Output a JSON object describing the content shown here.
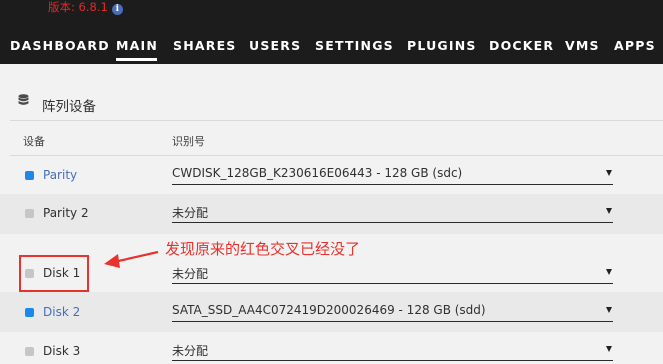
{
  "header": {
    "version": "版本: 6.8.1",
    "nav": [
      "DASHBOARD",
      "MAIN",
      "SHARES",
      "USERS",
      "SETTINGS",
      "PLUGINS",
      "DOCKER",
      "VMS",
      "APPS"
    ],
    "active_tab": "MAIN"
  },
  "panel": {
    "title": "阵列设备",
    "icon": "database-icon",
    "columns": {
      "device": "设备",
      "identification": "识别号"
    },
    "rows": [
      {
        "name": "Parity",
        "value": "CWDISK_128GB_K230616E06443 - 128 GB (sdc)",
        "status": "active",
        "is_link": true
      },
      {
        "name": "Parity 2",
        "value": "未分配",
        "status": "inactive",
        "is_link": false
      },
      {
        "name": "Disk 1",
        "value": "未分配",
        "status": "inactive",
        "is_link": false
      },
      {
        "name": "Disk 2",
        "value": "SATA_SSD_AA4C072419D200026469 - 128 GB (sdd)",
        "status": "active",
        "is_link": true
      },
      {
        "name": "Disk 3",
        "value": "未分配",
        "status": "inactive",
        "is_link": false
      }
    ]
  },
  "annotation": {
    "text": "发现原来的红色交叉已经没了"
  },
  "colors": {
    "header_bg": "#1c1c1c",
    "version_text": "#e22828",
    "link": "#486dba",
    "status_active": "#1e87e8",
    "status_inactive": "#c6c6c6",
    "annotation": "#e8322e"
  }
}
